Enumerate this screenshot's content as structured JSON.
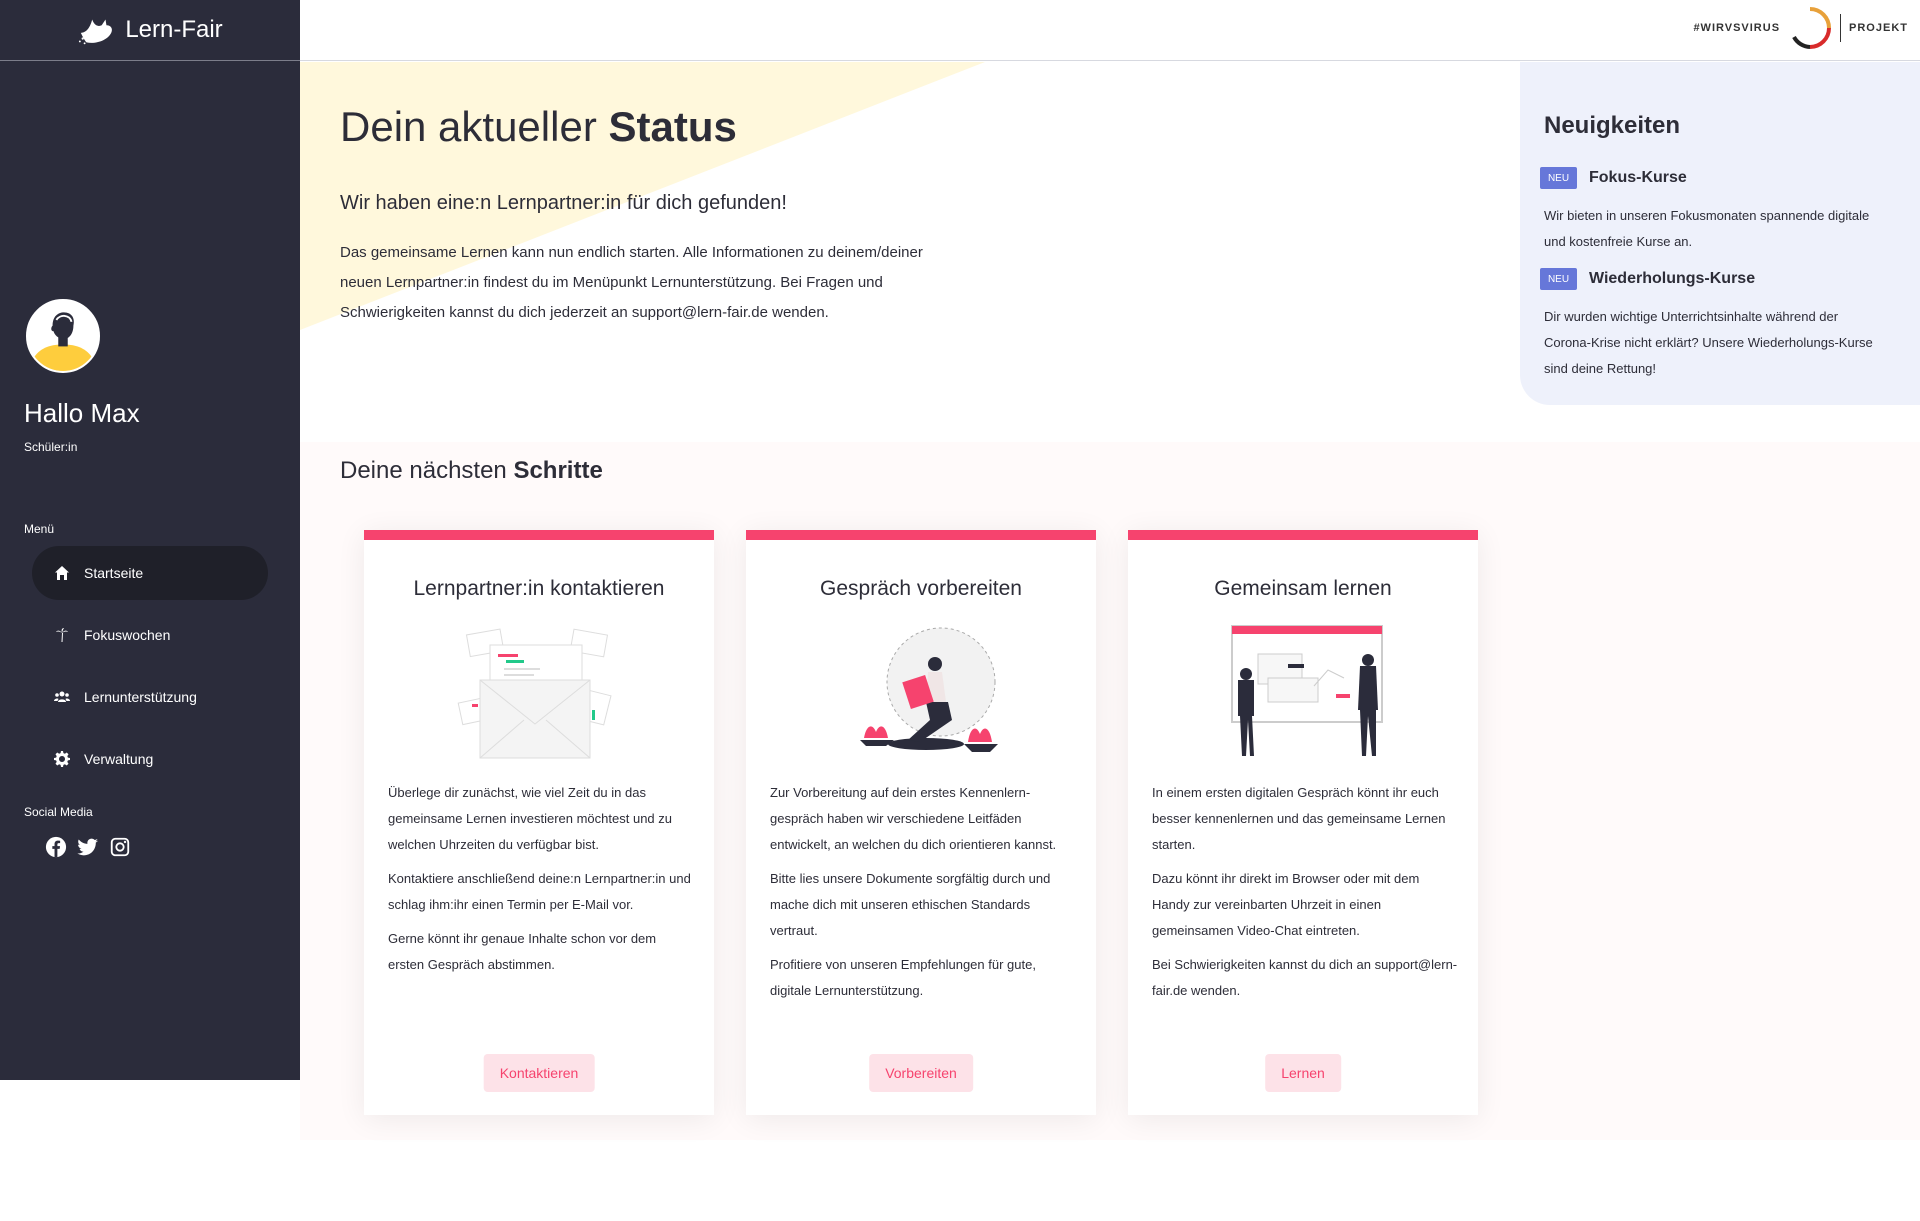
{
  "brand": {
    "name": "Lern-Fair"
  },
  "user": {
    "greeting": "Hallo Max",
    "role": "Schüler:in"
  },
  "sidebar": {
    "menu_label": "Menü",
    "items": [
      {
        "label": "Startseite",
        "icon": "home-icon",
        "active": true
      },
      {
        "label": "Fokuswochen",
        "icon": "palm-tree-icon",
        "active": false
      },
      {
        "label": "Lernunterstützung",
        "icon": "users-icon",
        "active": false
      },
      {
        "label": "Verwaltung",
        "icon": "gear-icon",
        "active": false
      }
    ],
    "social_label": "Social Media",
    "social": [
      "facebook-icon",
      "twitter-icon",
      "instagram-icon"
    ]
  },
  "header": {
    "partner_text": "#WIRVSVIRUS",
    "partner_suffix": "PROJEKT"
  },
  "status": {
    "title_prefix": "Dein aktueller",
    "title_highlight": "Status",
    "subtitle": "Wir haben eine:n Lernpartner:in für dich gefunden!",
    "text": "Das gemeinsame Lernen kann nun endlich starten. Alle Informationen zu deinem/deiner neuen Lernpartner:in findest du im Menüpunkt Lernunterstützung. Bei Fragen und Schwierigkeiten kannst du dich jederzeit an support@lern-fair.de wenden."
  },
  "news": {
    "title": "Neuigkeiten",
    "items": [
      {
        "badge": "NEU",
        "title": "Fokus-Kurse",
        "text": "Wir bieten in unseren Fokusmonaten spannende digitale und kostenfreie Kurse an."
      },
      {
        "badge": "NEU",
        "title": "Wiederholungs-Kurse",
        "text": "Dir wurden wichtige Unterrichtsinhalte während der Corona-Krise nicht erklärt? Unsere Wiederholungs-Kurse sind deine Rettung!"
      }
    ]
  },
  "steps": {
    "title_prefix": "Deine nächsten",
    "title_bold": "Schritte",
    "cards": [
      {
        "title": "Lernpartner:in kontaktieren",
        "illustration": "envelope-illustration",
        "paragraphs": [
          "Überlege dir zunächst, wie viel Zeit du in das gemeinsame Lernen investieren möchtest und zu welchen Uhrzeiten du verfügbar bist.",
          "Kontaktiere anschließend deine:n Lernpartner:in und schlag ihm:ihr einen Termin per E-Mail vor.",
          "Gerne könnt ihr genaue Inhalte schon vor dem ersten Gespräch abstimmen."
        ],
        "button": "Kontaktieren"
      },
      {
        "title": "Gespräch vorbereiten",
        "illustration": "reading-person-illustration",
        "paragraphs": [
          "Zur Vorbereitung auf dein erstes Kennenlern-gespräch haben wir verschiedene Leitfäden entwickelt, an welchen du dich orientieren kannst.",
          "Bitte lies unsere Dokumente sorgfältig durch und mache dich mit unseren ethischen Standards vertraut.",
          "Profitiere von unseren Empfehlungen für gute, digitale Lernunterstützung."
        ],
        "button": "Vorbereiten"
      },
      {
        "title": "Gemeinsam lernen",
        "illustration": "whiteboard-illustration",
        "paragraphs": [
          "In einem ersten digitalen Gespräch könnt ihr euch besser kennenlernen und das gemeinsame Lernen starten.",
          "Dazu könnt ihr direkt im Browser oder mit dem Handy zur vereinbarten Uhrzeit in einen gemeinsamen Video-Chat eintreten.",
          "Bei Schwierigkeiten kannst du dich an support@lern-fair.de wenden."
        ],
        "button": "Lernen"
      }
    ]
  },
  "colors": {
    "sidebar": "#2b2c3b",
    "accent": "#f6436e",
    "highlight": "#fecd3d",
    "news_bg": "#eef1fb",
    "badge": "#6677d9"
  }
}
